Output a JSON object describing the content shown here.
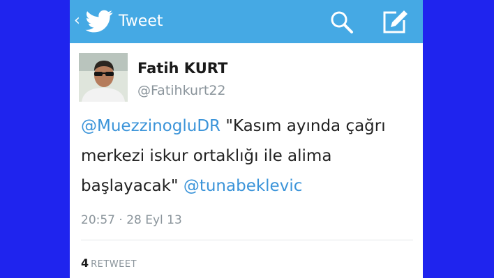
{
  "header": {
    "title": "Tweet",
    "back_icon": "chevron-left-icon",
    "logo_icon": "twitter-bird-icon",
    "actions": [
      "search-icon",
      "compose-icon"
    ],
    "bar_color": "#45a9e4"
  },
  "tweet": {
    "author_name": "Fatih KURT",
    "author_handle": "@Fatihkurt22",
    "mention_1": "@MuezzinogluDR",
    "text": " \"Kasım ayında çağrı merkezi iskur ortaklığı ile alima başlayacak\" ",
    "mention_2": "@tunabeklevic",
    "timestamp": "20:57 · 28 Eyl 13",
    "retweet_count": "4",
    "retweet_label": "RETWEET",
    "mention_color": "#3b94d9"
  },
  "background_color": "#1f24ee"
}
